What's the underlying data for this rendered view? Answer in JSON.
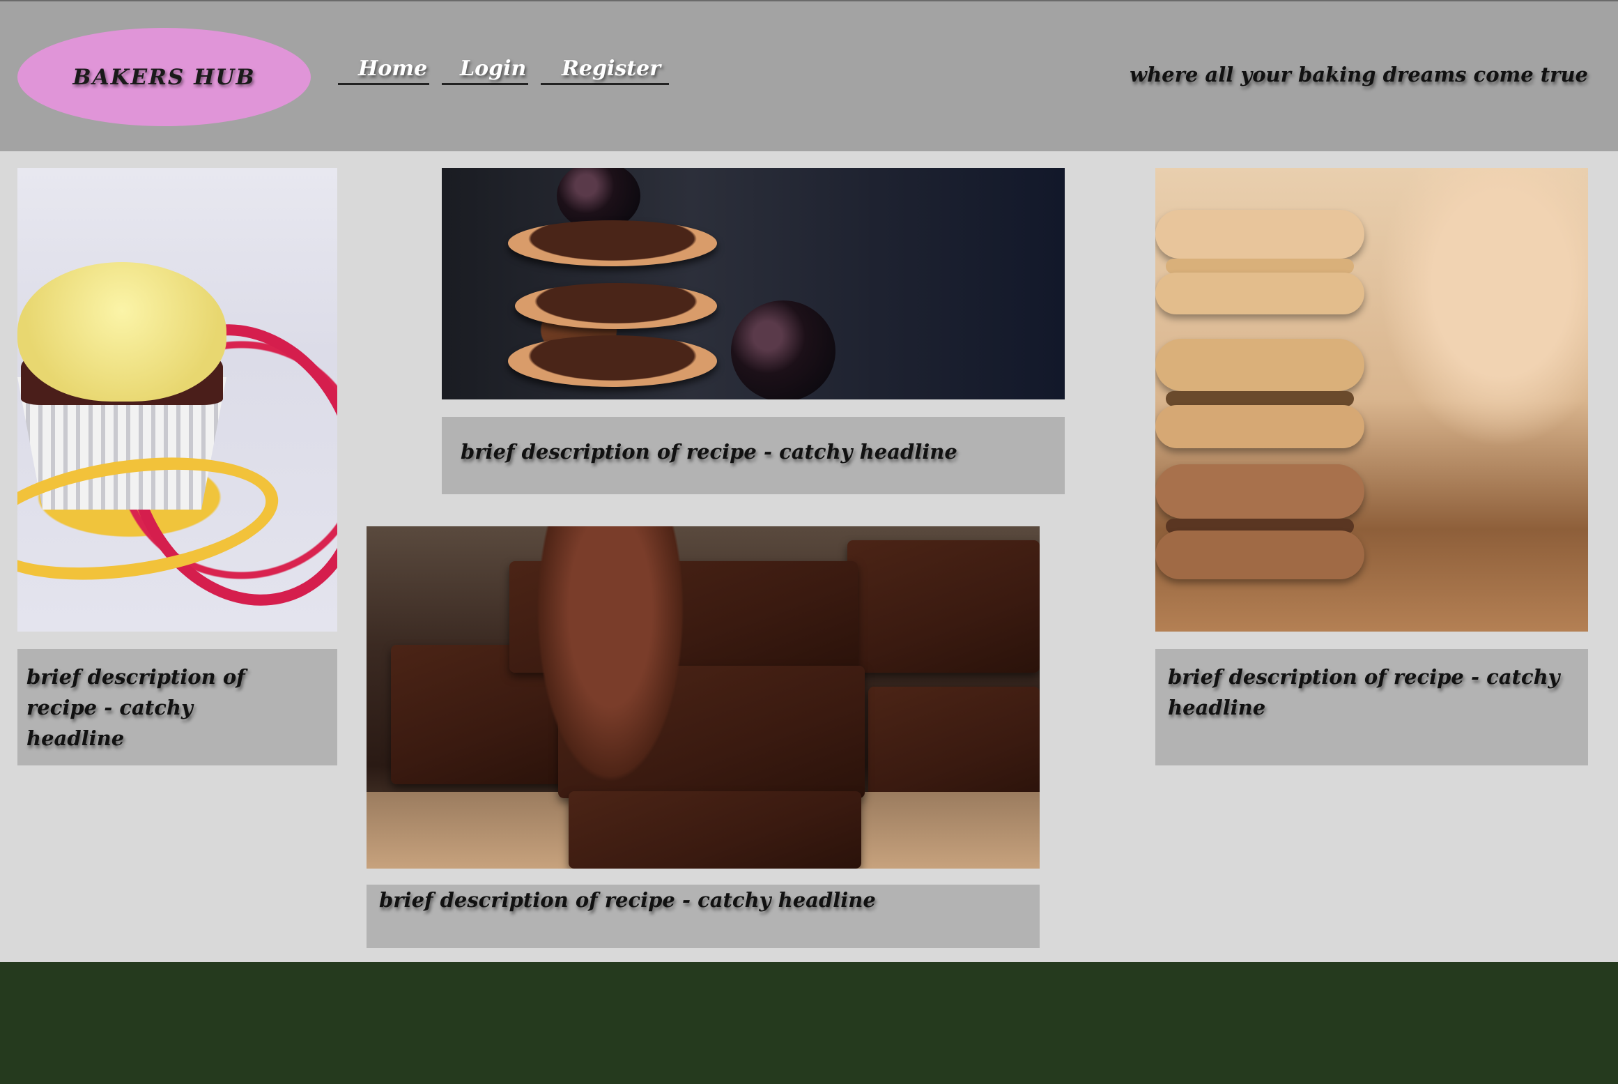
{
  "header": {
    "logo": "BAKERS HUB",
    "nav": [
      "Home",
      "Login",
      "Register"
    ],
    "tagline": "where all your baking dreams come true"
  },
  "cards": {
    "cupcake": {
      "caption_lines": [
        "brief description of",
        "recipe - catchy",
        "headline"
      ]
    },
    "cookies": {
      "caption": "brief description of recipe - catchy headline"
    },
    "brownies": {
      "caption": "brief description of recipe - catchy headline"
    },
    "macarons": {
      "caption_lines": [
        "brief description of recipe - catchy",
        "headline"
      ]
    }
  },
  "colors": {
    "header_bg": "#a3a3a3",
    "logo_bg": "#e095d8",
    "page_bg": "#d9d9d9",
    "caption_bg": "#b3b3b3",
    "footer_bg": "#253a1e"
  },
  "images": {
    "cupcake": "cupcake-photo",
    "cookies": "chocolate-cookies-photo",
    "brownies": "brownies-photo",
    "macarons": "macarons-photo"
  }
}
